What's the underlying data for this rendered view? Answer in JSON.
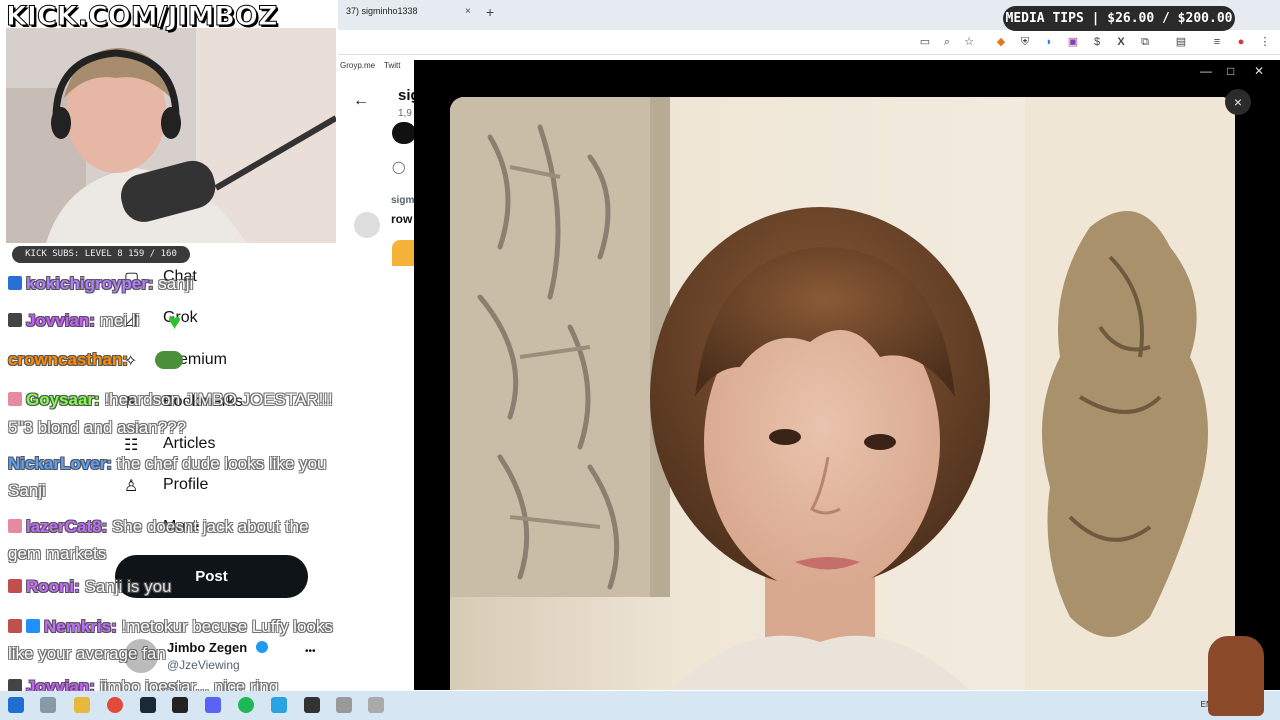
{
  "browser": {
    "tab_title": "37) sigminho1338",
    "tab_close": "×",
    "new_tab": "+",
    "bookmarks": [
      "Groyp.me",
      "Twitt"
    ]
  },
  "stream_overlay": {
    "channel_logo": "KICK.COM/JIMBOZ",
    "subs_bar": "KICK SUBS: LEVEL 8 159 / 160",
    "media_tips": "MEDIA TIPS | $26.00 / $200.00"
  },
  "twitter_nav": {
    "items": [
      "Chat",
      "Grok",
      "Premium",
      "Bookmarks",
      "Articles",
      "Profile",
      "More"
    ],
    "post_button": "Post",
    "account_name": "Jimbo Zegen",
    "account_handle": "@JzeViewing",
    "more_dots": "•••"
  },
  "background_page": {
    "back_arrow": "←",
    "title_partial": "sig",
    "count_partial": "1,9",
    "repost_partial": "sigm",
    "name_partial": "row"
  },
  "image_viewer": {
    "close": "×",
    "minimize": "—",
    "maximize": "□",
    "window_close": "✕"
  },
  "chat": [
    {
      "user": "kokichigroyper:",
      "message": "sanji",
      "color": "#b27cff"
    },
    {
      "user": "Jovvian:",
      "message": "mei li",
      "color": "#c75bff"
    },
    {
      "user": "crowncasthan:",
      "message": "",
      "color": "#ff8c00"
    },
    {
      "user": "Goysaar:",
      "message": "!heardson JIMBO JOESTAR!!! 5\"3 blond and asian???",
      "color": "#7dff4a"
    },
    {
      "user": "NickarLover:",
      "message": "the chef dude looks like you Sanji",
      "color": "#5aa0ff"
    },
    {
      "user": "lazerCat8:",
      "message": "She doesnt jack about the gem markets",
      "color": "#c36bff"
    },
    {
      "user": "Rooni:",
      "message": "Sanji is you",
      "color": "#c36bff"
    },
    {
      "user": "Nemkris:",
      "message": "!metokur becuse Luffy looks like your average fan",
      "color": "#c36bff"
    },
    {
      "user": "Jovvian:",
      "message": "jimbo joestar... nice ring",
      "color": "#c75bff"
    }
  ],
  "taskbar": {
    "lang": "ENG"
  }
}
